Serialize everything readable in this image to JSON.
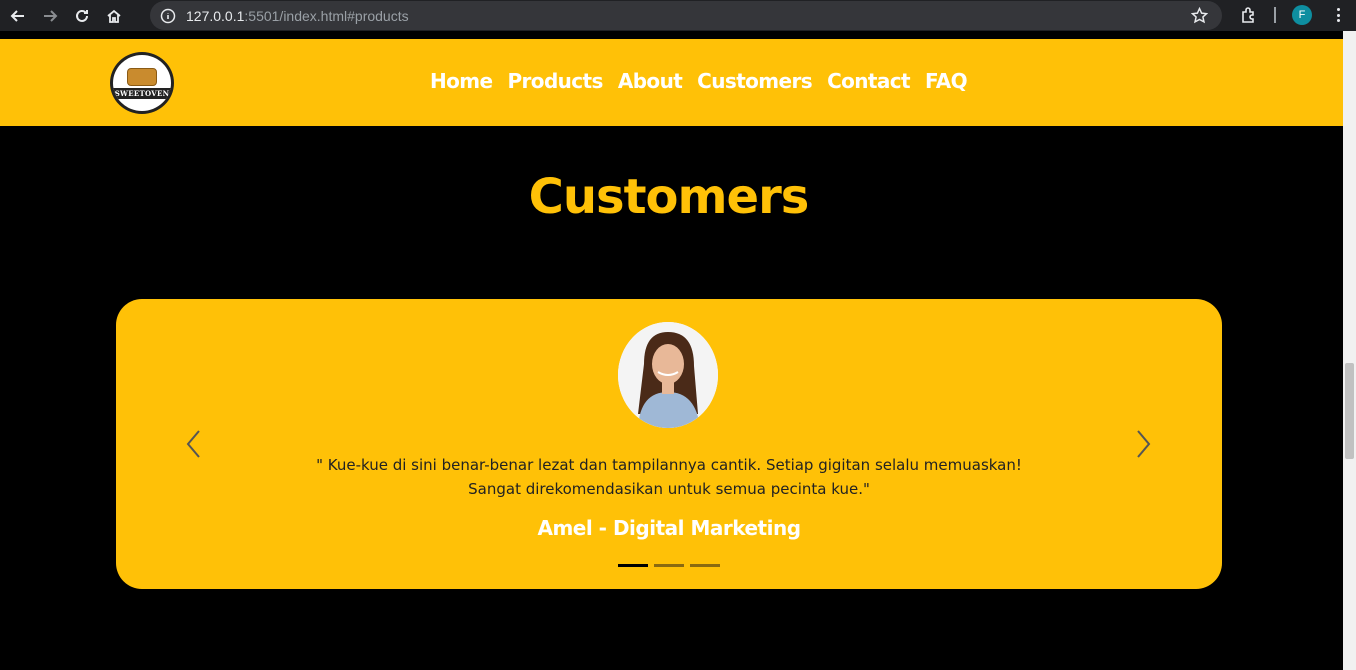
{
  "browser": {
    "url_host": "127.0.0.1",
    "url_rest": ":5501/index.html#products",
    "profile_initial": "F"
  },
  "nav": {
    "logo_text": "SWEETOVEN",
    "links": [
      "Home",
      "Products",
      "About",
      "Customers",
      "Contact",
      "FAQ"
    ]
  },
  "section": {
    "title": "Customers"
  },
  "testimonial": {
    "quote_line1": "\" Kue-kue di sini benar-benar lezat dan tampilannya cantik. Setiap gigitan selalu memuaskan!",
    "quote_line2": "Sangat direkomendasikan untuk semua pecinta kue.\"",
    "author": "Amel - Digital Marketing",
    "slides": 3,
    "active_slide": 1
  },
  "colors": {
    "accent": "#ffc107",
    "background": "#000000"
  }
}
